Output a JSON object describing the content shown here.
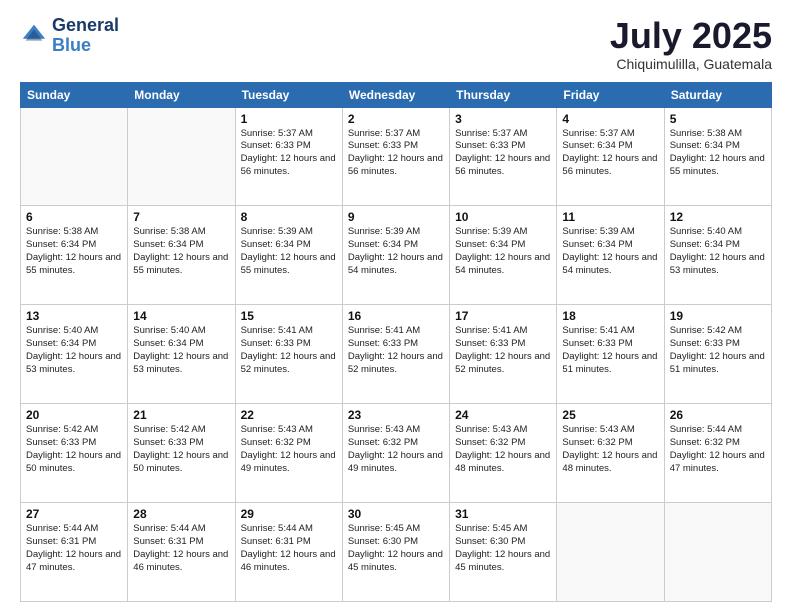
{
  "header": {
    "logo_line1": "General",
    "logo_line2": "Blue",
    "month": "July 2025",
    "location": "Chiquimulilla, Guatemala"
  },
  "days_of_week": [
    "Sunday",
    "Monday",
    "Tuesday",
    "Wednesday",
    "Thursday",
    "Friday",
    "Saturday"
  ],
  "weeks": [
    [
      {
        "day": "",
        "sunrise": "",
        "sunset": "",
        "daylight": ""
      },
      {
        "day": "",
        "sunrise": "",
        "sunset": "",
        "daylight": ""
      },
      {
        "day": "1",
        "sunrise": "Sunrise: 5:37 AM",
        "sunset": "Sunset: 6:33 PM",
        "daylight": "Daylight: 12 hours and 56 minutes."
      },
      {
        "day": "2",
        "sunrise": "Sunrise: 5:37 AM",
        "sunset": "Sunset: 6:33 PM",
        "daylight": "Daylight: 12 hours and 56 minutes."
      },
      {
        "day": "3",
        "sunrise": "Sunrise: 5:37 AM",
        "sunset": "Sunset: 6:33 PM",
        "daylight": "Daylight: 12 hours and 56 minutes."
      },
      {
        "day": "4",
        "sunrise": "Sunrise: 5:37 AM",
        "sunset": "Sunset: 6:34 PM",
        "daylight": "Daylight: 12 hours and 56 minutes."
      },
      {
        "day": "5",
        "sunrise": "Sunrise: 5:38 AM",
        "sunset": "Sunset: 6:34 PM",
        "daylight": "Daylight: 12 hours and 55 minutes."
      }
    ],
    [
      {
        "day": "6",
        "sunrise": "Sunrise: 5:38 AM",
        "sunset": "Sunset: 6:34 PM",
        "daylight": "Daylight: 12 hours and 55 minutes."
      },
      {
        "day": "7",
        "sunrise": "Sunrise: 5:38 AM",
        "sunset": "Sunset: 6:34 PM",
        "daylight": "Daylight: 12 hours and 55 minutes."
      },
      {
        "day": "8",
        "sunrise": "Sunrise: 5:39 AM",
        "sunset": "Sunset: 6:34 PM",
        "daylight": "Daylight: 12 hours and 55 minutes."
      },
      {
        "day": "9",
        "sunrise": "Sunrise: 5:39 AM",
        "sunset": "Sunset: 6:34 PM",
        "daylight": "Daylight: 12 hours and 54 minutes."
      },
      {
        "day": "10",
        "sunrise": "Sunrise: 5:39 AM",
        "sunset": "Sunset: 6:34 PM",
        "daylight": "Daylight: 12 hours and 54 minutes."
      },
      {
        "day": "11",
        "sunrise": "Sunrise: 5:39 AM",
        "sunset": "Sunset: 6:34 PM",
        "daylight": "Daylight: 12 hours and 54 minutes."
      },
      {
        "day": "12",
        "sunrise": "Sunrise: 5:40 AM",
        "sunset": "Sunset: 6:34 PM",
        "daylight": "Daylight: 12 hours and 53 minutes."
      }
    ],
    [
      {
        "day": "13",
        "sunrise": "Sunrise: 5:40 AM",
        "sunset": "Sunset: 6:34 PM",
        "daylight": "Daylight: 12 hours and 53 minutes."
      },
      {
        "day": "14",
        "sunrise": "Sunrise: 5:40 AM",
        "sunset": "Sunset: 6:34 PM",
        "daylight": "Daylight: 12 hours and 53 minutes."
      },
      {
        "day": "15",
        "sunrise": "Sunrise: 5:41 AM",
        "sunset": "Sunset: 6:33 PM",
        "daylight": "Daylight: 12 hours and 52 minutes."
      },
      {
        "day": "16",
        "sunrise": "Sunrise: 5:41 AM",
        "sunset": "Sunset: 6:33 PM",
        "daylight": "Daylight: 12 hours and 52 minutes."
      },
      {
        "day": "17",
        "sunrise": "Sunrise: 5:41 AM",
        "sunset": "Sunset: 6:33 PM",
        "daylight": "Daylight: 12 hours and 52 minutes."
      },
      {
        "day": "18",
        "sunrise": "Sunrise: 5:41 AM",
        "sunset": "Sunset: 6:33 PM",
        "daylight": "Daylight: 12 hours and 51 minutes."
      },
      {
        "day": "19",
        "sunrise": "Sunrise: 5:42 AM",
        "sunset": "Sunset: 6:33 PM",
        "daylight": "Daylight: 12 hours and 51 minutes."
      }
    ],
    [
      {
        "day": "20",
        "sunrise": "Sunrise: 5:42 AM",
        "sunset": "Sunset: 6:33 PM",
        "daylight": "Daylight: 12 hours and 50 minutes."
      },
      {
        "day": "21",
        "sunrise": "Sunrise: 5:42 AM",
        "sunset": "Sunset: 6:33 PM",
        "daylight": "Daylight: 12 hours and 50 minutes."
      },
      {
        "day": "22",
        "sunrise": "Sunrise: 5:43 AM",
        "sunset": "Sunset: 6:32 PM",
        "daylight": "Daylight: 12 hours and 49 minutes."
      },
      {
        "day": "23",
        "sunrise": "Sunrise: 5:43 AM",
        "sunset": "Sunset: 6:32 PM",
        "daylight": "Daylight: 12 hours and 49 minutes."
      },
      {
        "day": "24",
        "sunrise": "Sunrise: 5:43 AM",
        "sunset": "Sunset: 6:32 PM",
        "daylight": "Daylight: 12 hours and 48 minutes."
      },
      {
        "day": "25",
        "sunrise": "Sunrise: 5:43 AM",
        "sunset": "Sunset: 6:32 PM",
        "daylight": "Daylight: 12 hours and 48 minutes."
      },
      {
        "day": "26",
        "sunrise": "Sunrise: 5:44 AM",
        "sunset": "Sunset: 6:32 PM",
        "daylight": "Daylight: 12 hours and 47 minutes."
      }
    ],
    [
      {
        "day": "27",
        "sunrise": "Sunrise: 5:44 AM",
        "sunset": "Sunset: 6:31 PM",
        "daylight": "Daylight: 12 hours and 47 minutes."
      },
      {
        "day": "28",
        "sunrise": "Sunrise: 5:44 AM",
        "sunset": "Sunset: 6:31 PM",
        "daylight": "Daylight: 12 hours and 46 minutes."
      },
      {
        "day": "29",
        "sunrise": "Sunrise: 5:44 AM",
        "sunset": "Sunset: 6:31 PM",
        "daylight": "Daylight: 12 hours and 46 minutes."
      },
      {
        "day": "30",
        "sunrise": "Sunrise: 5:45 AM",
        "sunset": "Sunset: 6:30 PM",
        "daylight": "Daylight: 12 hours and 45 minutes."
      },
      {
        "day": "31",
        "sunrise": "Sunrise: 5:45 AM",
        "sunset": "Sunset: 6:30 PM",
        "daylight": "Daylight: 12 hours and 45 minutes."
      },
      {
        "day": "",
        "sunrise": "",
        "sunset": "",
        "daylight": ""
      },
      {
        "day": "",
        "sunrise": "",
        "sunset": "",
        "daylight": ""
      }
    ]
  ]
}
